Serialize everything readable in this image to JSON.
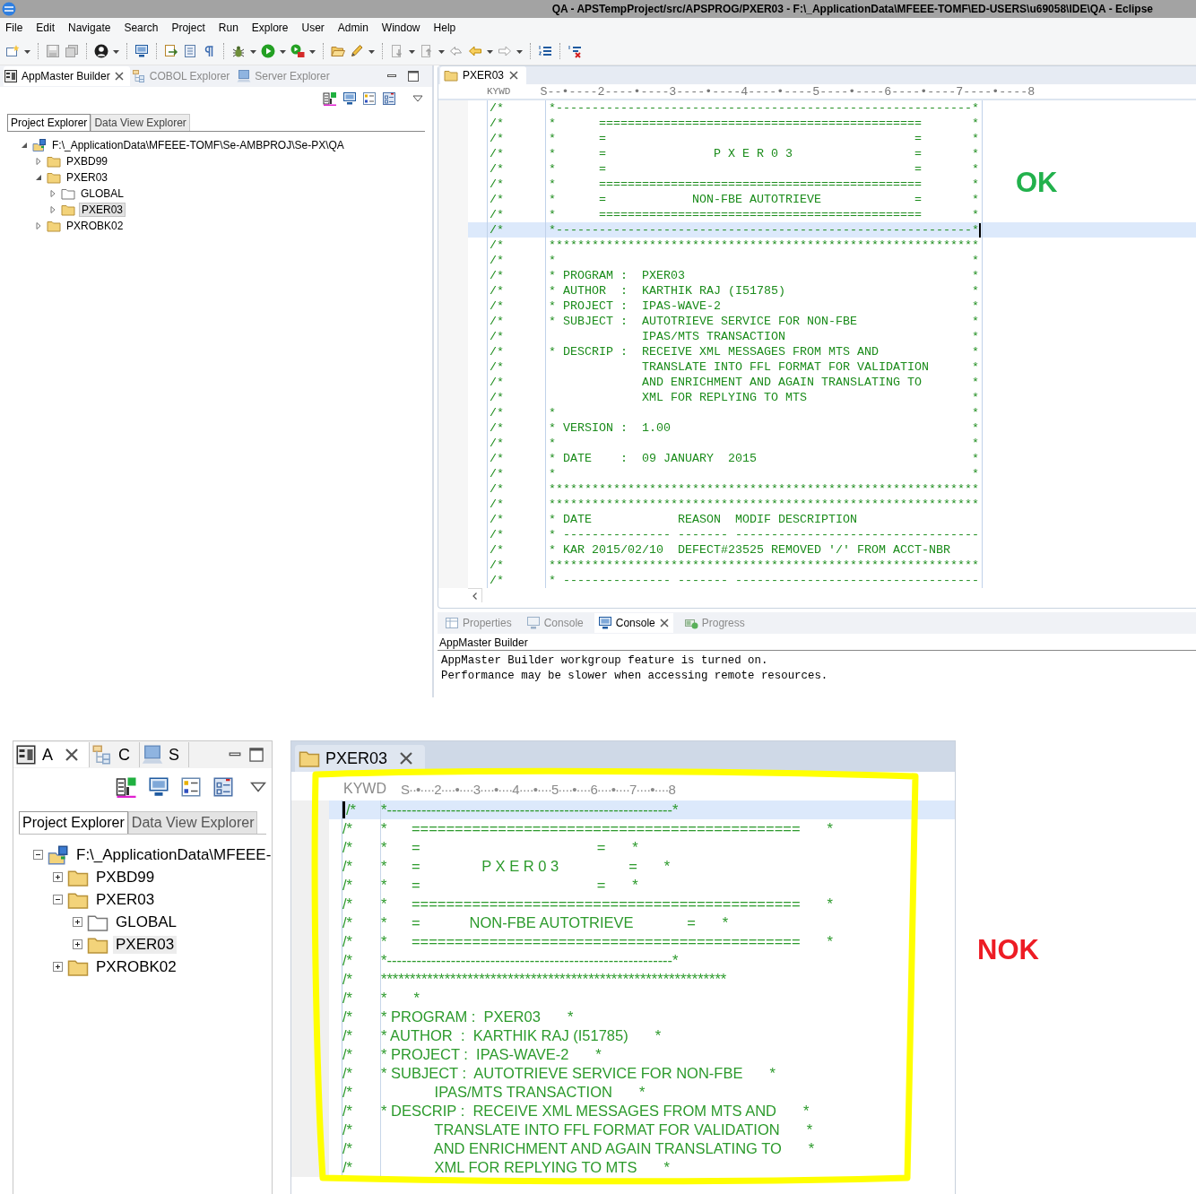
{
  "window": {
    "title": "QA - APSTempProject/src/APSPROG/PXER03 - F:\\_ApplicationData\\MFEEE-TOMF\\ED-USERS\\u69058\\IDE\\QA - Eclipse"
  },
  "menu": [
    "File",
    "Edit",
    "Navigate",
    "Search",
    "Project",
    "Run",
    "Explore",
    "User",
    "Admin",
    "Window",
    "Help"
  ],
  "ok_view": {
    "left_panel": {
      "tabs": [
        {
          "label": "AppMaster Builder",
          "selected": true
        },
        {
          "label": "COBOL Explorer",
          "selected": false
        },
        {
          "label": "Server Explorer",
          "selected": false
        }
      ],
      "explorer_tabs": [
        {
          "label": "Project Explorer",
          "selected": true
        },
        {
          "label": "Data View Explorer",
          "selected": false
        }
      ],
      "tree": [
        {
          "label": "F:\\_ApplicationData\\MFEEE-TOMF\\Se-AMBPROJ\\Se-PX\\QA",
          "kind": "project",
          "expanded": true,
          "selected": false,
          "children": [
            {
              "label": "PXBD99",
              "kind": "folder",
              "expanded": false,
              "selected": false
            },
            {
              "label": "PXER03",
              "kind": "folder",
              "expanded": true,
              "selected": false,
              "children": [
                {
                  "label": "GLOBAL",
                  "kind": "empty-folder",
                  "expanded": false,
                  "selected": false
                },
                {
                  "label": "PXER03",
                  "kind": "folder",
                  "expanded": false,
                  "selected": true
                }
              ]
            },
            {
              "label": "PXROBK02",
              "kind": "folder",
              "expanded": false,
              "selected": false
            }
          ]
        }
      ]
    },
    "editor": {
      "tab": "PXER03",
      "ruler_label": "KYWD",
      "ruler": "S--•----2----•----3----•----4----•----5----•----6----•----7----•----8",
      "lines": [
        {
          "prefix": "/*",
          "text": "*----------------------------------------------------------*",
          "current": false
        },
        {
          "prefix": "/*",
          "text": "*      =============================================",
          "end": "*",
          "current": false
        },
        {
          "prefix": "/*",
          "text": "*      =                                           =",
          "end": "*",
          "current": false
        },
        {
          "prefix": "/*",
          "text": "*      =               P X E R 0 3                 =",
          "end": "*",
          "current": false
        },
        {
          "prefix": "/*",
          "text": "*      =                                           =",
          "end": "*",
          "current": false
        },
        {
          "prefix": "/*",
          "text": "*      =============================================",
          "end": "*",
          "current": false
        },
        {
          "prefix": "/*",
          "text": "*      =            NON-FBE AUTOTRIEVE             =",
          "end": "*",
          "current": false
        },
        {
          "prefix": "/*",
          "text": "*      =============================================",
          "end": "*",
          "current": false
        },
        {
          "prefix": "/*",
          "text": "*----------------------------------------------------------*",
          "current": true
        },
        {
          "prefix": "/*",
          "text": "************************************************************",
          "current": false
        },
        {
          "prefix": "/*",
          "text": "*",
          "end": "*",
          "current": false
        },
        {
          "prefix": "/*",
          "text": "* PROGRAM :  PXER03",
          "end": "*",
          "current": false
        },
        {
          "prefix": "/*",
          "text": "* AUTHOR  :  KARTHIK RAJ (I51785)",
          "end": "*",
          "current": false
        },
        {
          "prefix": "/*",
          "text": "* PROJECT :  IPAS-WAVE-2",
          "end": "*",
          "current": false
        },
        {
          "prefix": "/*",
          "text": "* SUBJECT :  AUTOTRIEVE SERVICE FOR NON-FBE",
          "end": "*",
          "current": false
        },
        {
          "prefix": "/*",
          "text": "             IPAS/MTS TRANSACTION",
          "end": "*",
          "current": false
        },
        {
          "prefix": "/*",
          "text": "* DESCRIP :  RECEIVE XML MESSAGES FROM MTS AND",
          "end": "*",
          "current": false
        },
        {
          "prefix": "/*",
          "text": "             TRANSLATE INTO FFL FORMAT FOR VALIDATION",
          "end": "*",
          "current": false
        },
        {
          "prefix": "/*",
          "text": "             AND ENRICHMENT AND AGAIN TRANSLATING TO",
          "end": "*",
          "current": false
        },
        {
          "prefix": "/*",
          "text": "             XML FOR REPLYING TO MTS",
          "end": "*",
          "current": false
        },
        {
          "prefix": "/*",
          "text": "*",
          "end": "*",
          "current": false
        },
        {
          "prefix": "/*",
          "text": "* VERSION :  1.00",
          "end": "*",
          "current": false
        },
        {
          "prefix": "/*",
          "text": "*",
          "end": "*",
          "current": false
        },
        {
          "prefix": "/*",
          "text": "* DATE    :  09 JANUARY  2015",
          "end": "*",
          "current": false
        },
        {
          "prefix": "/*",
          "text": "*",
          "end": "*",
          "current": false
        },
        {
          "prefix": "/*",
          "text": "************************************************************",
          "current": false
        },
        {
          "prefix": "/*",
          "text": "************************************************************",
          "current": false
        },
        {
          "prefix": "/*",
          "text": "* DATE            REASON  MODIF DESCRIPTION",
          "current": false
        },
        {
          "prefix": "/*",
          "text": "* --------------- ------- ----------------------------------",
          "current": false
        },
        {
          "prefix": "/*",
          "text": "* KAR 2015/02/10  DEFECT#23525 REMOVED '/' FROM ACCT-NBR",
          "current": false
        },
        {
          "prefix": "/*",
          "text": "************************************************************",
          "current": false
        },
        {
          "prefix": "/*",
          "text": "* --------------- ------- ----------------------------------",
          "current": false
        }
      ]
    },
    "console": {
      "tabs": [
        {
          "label": "Properties",
          "selected": false
        },
        {
          "label": "Console",
          "selected": false
        },
        {
          "label": "Console",
          "selected": true
        },
        {
          "label": "Progress",
          "selected": false
        }
      ],
      "title": "AppMaster Builder",
      "lines": [
        "AppMaster Builder workgroup feature is turned on.",
        "Performance may be slower when accessing remote resources."
      ]
    },
    "verdict": {
      "text": "OK",
      "kind": "pass"
    }
  },
  "nok_view": {
    "left_panel": {
      "tabs": [
        {
          "label": "A",
          "selected": true
        },
        {
          "label": "C",
          "selected": false
        },
        {
          "label": "S",
          "selected": false
        }
      ],
      "explorer_tabs": [
        {
          "label": "Project Explorer",
          "selected": true
        },
        {
          "label": "Data View Explorer",
          "selected": false
        }
      ],
      "tree": [
        {
          "label": "F:\\_ApplicationData\\MFEEE-",
          "kind": "project",
          "expanded": true,
          "selected": false,
          "children": [
            {
              "label": "PXBD99",
              "kind": "folder",
              "expanded": false,
              "selected": false
            },
            {
              "label": "PXER03",
              "kind": "folder",
              "expanded": true,
              "selected": false,
              "children": [
                {
                  "label": "GLOBAL",
                  "kind": "empty-folder",
                  "expanded": false,
                  "selected": false
                },
                {
                  "label": "PXER03",
                  "kind": "folder",
                  "expanded": false,
                  "selected": true
                }
              ]
            },
            {
              "label": "PXROBK02",
              "kind": "folder",
              "expanded": false,
              "selected": false
            }
          ]
        }
      ]
    },
    "editor": {
      "tab": "PXER03",
      "ruler_label": "KYWD",
      "ruler": "S··•····2····•····3····•····4····•····5····•····6····•····7····•····8",
      "lines": [
        {
          "prefix": "/*",
          "text": "*----------------------------------------------------------*",
          "current": true
        },
        {
          "prefix": "/*",
          "text": "*      =============================================",
          "end": "*",
          "current": false
        },
        {
          "prefix": "/*",
          "text": "*      =                                           =",
          "end": "*",
          "current": false
        },
        {
          "prefix": "/*",
          "text": "*      =               P X E R 0 3                 =",
          "end": "*",
          "current": false
        },
        {
          "prefix": "/*",
          "text": "*      =                                           =",
          "end": "*",
          "current": false
        },
        {
          "prefix": "/*",
          "text": "*      =============================================",
          "end": "*",
          "current": false
        },
        {
          "prefix": "/*",
          "text": "*      =            NON-FBE AUTOTRIEVE             =",
          "end": "*",
          "current": false
        },
        {
          "prefix": "/*",
          "text": "*      =============================================",
          "end": "*",
          "current": false
        },
        {
          "prefix": "/*",
          "text": "*----------------------------------------------------------*",
          "current": false
        },
        {
          "prefix": "/*",
          "text": "************************************************************",
          "current": false
        },
        {
          "prefix": "/*",
          "text": "*",
          "end": "*",
          "current": false
        },
        {
          "prefix": "/*",
          "text": "* PROGRAM :  PXER03",
          "end": "*",
          "current": false
        },
        {
          "prefix": "/*",
          "text": "* AUTHOR  :  KARTHIK RAJ (I51785)",
          "end": "*",
          "current": false
        },
        {
          "prefix": "/*",
          "text": "* PROJECT :  IPAS-WAVE-2",
          "end": "*",
          "current": false
        },
        {
          "prefix": "/*",
          "text": "* SUBJECT :  AUTOTRIEVE SERVICE FOR NON-FBE",
          "end": "*",
          "current": false
        },
        {
          "prefix": "/*",
          "text": "             IPAS/MTS TRANSACTION",
          "end": "*",
          "current": false
        },
        {
          "prefix": "/*",
          "text": "* DESCRIP :  RECEIVE XML MESSAGES FROM MTS AND",
          "end": "*",
          "current": false
        },
        {
          "prefix": "/*",
          "text": "             TRANSLATE INTO FFL FORMAT FOR VALIDATION",
          "end": "*",
          "current": false
        },
        {
          "prefix": "/*",
          "text": "             AND ENRICHMENT AND AGAIN TRANSLATING TO",
          "end": "*",
          "current": false
        },
        {
          "prefix": "/*",
          "text": "             XML FOR REPLYING TO MTS",
          "end": "*",
          "current": false
        }
      ]
    },
    "verdict": {
      "text": "NOK",
      "kind": "fail"
    }
  }
}
